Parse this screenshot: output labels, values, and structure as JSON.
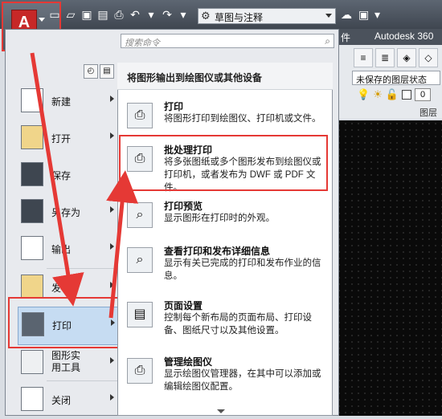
{
  "app": {
    "logo_letter": "A",
    "workspace": "草图与注释",
    "tabs_partial": "件",
    "tab_autodesk": "Autodesk 360",
    "layer_state": "未保存的图层状态",
    "layer_value": "0",
    "layer_panel_label": "图层"
  },
  "menu": {
    "search_placeholder": "搜索命令",
    "left_items": [
      {
        "label": "新建"
      },
      {
        "label": "打开"
      },
      {
        "label": "保存"
      },
      {
        "label": "另存为"
      },
      {
        "label": "输出"
      },
      {
        "label": "发布"
      },
      {
        "label": "打印"
      },
      {
        "label": "图形实用工具"
      },
      {
        "label": "关闭"
      }
    ],
    "submenu_title": "将图形输出到绘图仪或其他设备",
    "submenu_items": [
      {
        "title": "打印",
        "desc": "将图形打印到绘图仪、打印机或文件。"
      },
      {
        "title": "批处理打印",
        "desc": "将多张图纸或多个图形发布到绘图仪或打印机，或者发布为 DWF 或 PDF 文件。"
      },
      {
        "title": "打印预览",
        "desc": "显示图形在打印时的外观。"
      },
      {
        "title": "查看打印和发布详细信息",
        "desc": "显示有关已完成的打印和发布作业的信息。"
      },
      {
        "title": "页面设置",
        "desc": "控制每个新布局的页面布局、打印设备、图纸尺寸以及其他设置。"
      },
      {
        "title": "管理绘图仪",
        "desc": "显示绘图仪管理器，在其中可以添加或编辑绘图仪配置。"
      }
    ]
  },
  "colors": {
    "highlight_red": "#e53935",
    "accent_blue": "#c6dcf2"
  }
}
